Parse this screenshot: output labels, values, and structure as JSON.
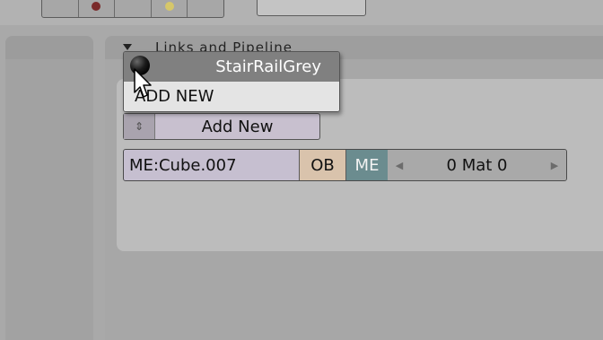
{
  "panel": {
    "title": "Links and Pipeline"
  },
  "popup": {
    "selected_material": "StairRailGrey",
    "add_new_item": "ADD NEW"
  },
  "material_button": {
    "label": "Add New",
    "arrows_icon": "updown-arrows-icon"
  },
  "mesh_row": {
    "mesh_name": "ME:Cube.007",
    "ob_label": "OB",
    "me_label": "ME",
    "mat_label": "0 Mat 0"
  },
  "colors": {
    "me_active": "#6b8c8f",
    "ob_button": "#d9c3ac",
    "name_field": "#c6bfd0"
  }
}
